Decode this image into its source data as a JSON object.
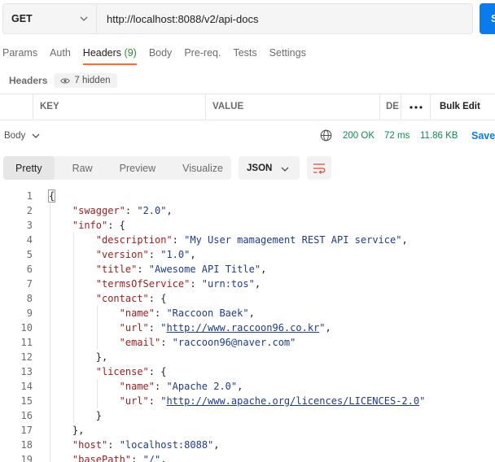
{
  "request": {
    "method": "GET",
    "url": "http://localhost:8088/v2/api-docs",
    "send_label": "Send"
  },
  "request_tabs": [
    {
      "label": "Params",
      "active": false
    },
    {
      "label": "Auth",
      "active": false
    },
    {
      "label": "Headers",
      "count": "(9)",
      "active": true
    },
    {
      "label": "Body",
      "active": false
    },
    {
      "label": "Pre-req.",
      "active": false
    },
    {
      "label": "Tests",
      "active": false
    },
    {
      "label": "Settings",
      "active": false
    }
  ],
  "headers_section": {
    "title": "Headers",
    "hidden_label": "7 hidden"
  },
  "table": {
    "key_header": "KEY",
    "value_header": "VALUE",
    "desc_header": "DE",
    "bulk_edit_label": "Bulk Edit"
  },
  "response": {
    "body_label": "Body",
    "status": "200 OK",
    "time": "72 ms",
    "size": "11.86 KB",
    "save_label": "Save"
  },
  "view_tabs": [
    "Pretty",
    "Raw",
    "Preview",
    "Visualize"
  ],
  "active_view": "Pretty",
  "format": "JSON",
  "code_lines": [
    {
      "n": "1",
      "indent": 0,
      "tokens": [
        {
          "t": "{",
          "c": "p"
        }
      ]
    },
    {
      "n": "2",
      "indent": 1,
      "tokens": [
        {
          "t": "\"swagger\"",
          "c": "k"
        },
        {
          "t": ": ",
          "c": "p"
        },
        {
          "t": "\"2.0\"",
          "c": "s"
        },
        {
          "t": ",",
          "c": "p"
        }
      ]
    },
    {
      "n": "3",
      "indent": 1,
      "tokens": [
        {
          "t": "\"info\"",
          "c": "k"
        },
        {
          "t": ": {",
          "c": "p"
        }
      ]
    },
    {
      "n": "4",
      "indent": 2,
      "tokens": [
        {
          "t": "\"description\"",
          "c": "k"
        },
        {
          "t": ": ",
          "c": "p"
        },
        {
          "t": "\"My User mamagement REST API service\"",
          "c": "s"
        },
        {
          "t": ",",
          "c": "p"
        }
      ]
    },
    {
      "n": "5",
      "indent": 2,
      "tokens": [
        {
          "t": "\"version\"",
          "c": "k"
        },
        {
          "t": ": ",
          "c": "p"
        },
        {
          "t": "\"1.0\"",
          "c": "s"
        },
        {
          "t": ",",
          "c": "p"
        }
      ]
    },
    {
      "n": "6",
      "indent": 2,
      "tokens": [
        {
          "t": "\"title\"",
          "c": "k"
        },
        {
          "t": ": ",
          "c": "p"
        },
        {
          "t": "\"Awesome API Title\"",
          "c": "s"
        },
        {
          "t": ",",
          "c": "p"
        }
      ]
    },
    {
      "n": "7",
      "indent": 2,
      "tokens": [
        {
          "t": "\"termsOfService\"",
          "c": "k"
        },
        {
          "t": ": ",
          "c": "p"
        },
        {
          "t": "\"urn:tos\"",
          "c": "s"
        },
        {
          "t": ",",
          "c": "p"
        }
      ]
    },
    {
      "n": "8",
      "indent": 2,
      "tokens": [
        {
          "t": "\"contact\"",
          "c": "k"
        },
        {
          "t": ": {",
          "c": "p"
        }
      ]
    },
    {
      "n": "9",
      "indent": 3,
      "tokens": [
        {
          "t": "\"name\"",
          "c": "k"
        },
        {
          "t": ": ",
          "c": "p"
        },
        {
          "t": "\"Raccoon Baek\"",
          "c": "s"
        },
        {
          "t": ",",
          "c": "p"
        }
      ]
    },
    {
      "n": "10",
      "indent": 3,
      "tokens": [
        {
          "t": "\"url\"",
          "c": "k"
        },
        {
          "t": ": ",
          "c": "p"
        },
        {
          "t": "\"",
          "c": "s"
        },
        {
          "t": "http://www.raccoon96.co.kr",
          "c": "s u"
        },
        {
          "t": "\"",
          "c": "s"
        },
        {
          "t": ",",
          "c": "p"
        }
      ]
    },
    {
      "n": "11",
      "indent": 3,
      "tokens": [
        {
          "t": "\"email\"",
          "c": "k"
        },
        {
          "t": ": ",
          "c": "p"
        },
        {
          "t": "\"raccoon96@naver.com\"",
          "c": "s"
        }
      ]
    },
    {
      "n": "12",
      "indent": 2,
      "tokens": [
        {
          "t": "},",
          "c": "p"
        }
      ]
    },
    {
      "n": "13",
      "indent": 2,
      "tokens": [
        {
          "t": "\"license\"",
          "c": "k"
        },
        {
          "t": ": {",
          "c": "p"
        }
      ]
    },
    {
      "n": "14",
      "indent": 3,
      "tokens": [
        {
          "t": "\"name\"",
          "c": "k"
        },
        {
          "t": ": ",
          "c": "p"
        },
        {
          "t": "\"Apache 2.0\"",
          "c": "s"
        },
        {
          "t": ",",
          "c": "p"
        }
      ]
    },
    {
      "n": "15",
      "indent": 3,
      "tokens": [
        {
          "t": "\"url\"",
          "c": "k"
        },
        {
          "t": ": ",
          "c": "p"
        },
        {
          "t": "\"",
          "c": "s"
        },
        {
          "t": "http://www.apache.org/licences/LICENCES-2.0",
          "c": "s u"
        },
        {
          "t": "\"",
          "c": "s"
        }
      ]
    },
    {
      "n": "16",
      "indent": 2,
      "tokens": [
        {
          "t": "}",
          "c": "p"
        }
      ]
    },
    {
      "n": "17",
      "indent": 1,
      "tokens": [
        {
          "t": "},",
          "c": "p"
        }
      ]
    },
    {
      "n": "18",
      "indent": 1,
      "tokens": [
        {
          "t": "\"host\"",
          "c": "k"
        },
        {
          "t": ": ",
          "c": "p"
        },
        {
          "t": "\"localhost:8088\"",
          "c": "s"
        },
        {
          "t": ",",
          "c": "p"
        }
      ]
    },
    {
      "n": "19",
      "indent": 1,
      "tokens": [
        {
          "t": "\"basePath\"",
          "c": "k"
        },
        {
          "t": ": ",
          "c": "p"
        },
        {
          "t": "\"/\"",
          "c": "s"
        },
        {
          "t": ",",
          "c": "p"
        }
      ]
    }
  ],
  "colors": {
    "accent_orange": "#ff6c37",
    "send_blue": "#097bed",
    "status_green": "#0f8a4f",
    "json_key": "#a11d1d",
    "json_string": "#1d3b8f"
  }
}
